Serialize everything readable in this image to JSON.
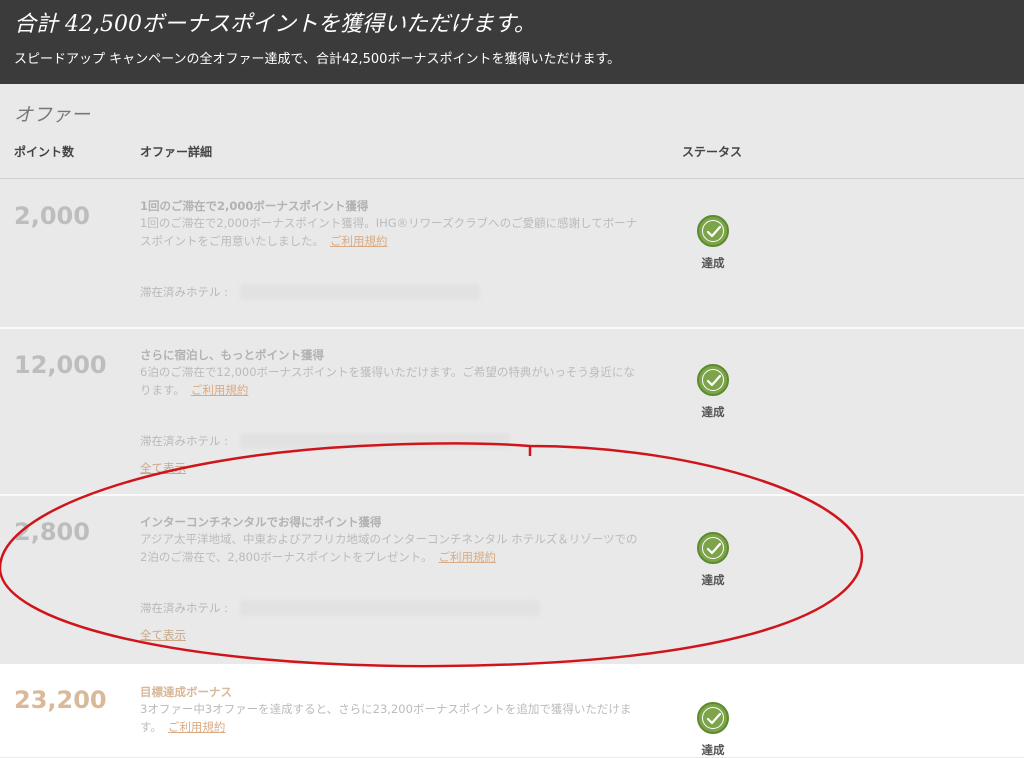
{
  "banner": {
    "title": "合計 42,500ボーナスポイントを獲得いただけます。",
    "subtitle": "スピードアップ キャンペーンの全オファー達成で、合計42,500ボーナスポイントを獲得いただけます。"
  },
  "section": {
    "title": "オファー"
  },
  "columns": {
    "points": "ポイント数",
    "details": "オファー詳細",
    "status": "ステータス"
  },
  "offers": [
    {
      "points": "2,000",
      "title": "1回のご滞在で2,000ボーナスポイント獲得",
      "description": "1回のご滞在で2,000ボーナスポイント獲得。IHG®リワーズクラブへのご愛顧に感謝してボーナスポイントをご用意いたしました。",
      "terms": "ご利用規約",
      "stay_label": "滞在済みホテル :",
      "status": "達成"
    },
    {
      "points": "12,000",
      "title": "さらに宿泊し、もっとポイント獲得",
      "description": "6泊のご滞在で12,000ボーナスポイントを獲得いただけます。ご希望の特典がいっそう身近になります。",
      "terms": "ご利用規約",
      "stay_label": "滞在済みホテル :",
      "show_all": "全て表示",
      "status": "達成"
    },
    {
      "points": "2,800",
      "title": "インターコンチネンタルでお得にポイント獲得",
      "description": "アジア太平洋地域、中東およびアフリカ地域のインターコンチネンタル ホテルズ＆リゾーツでの2泊のご滞在で、2,800ボーナスポイントをプレゼント。",
      "terms": "ご利用規約",
      "stay_label": "滞在済みホテル :",
      "show_all": "全て表示",
      "status": "達成"
    },
    {
      "points": "23,200",
      "title": "目標達成ボーナス",
      "description": "3オファー中3オファーを達成すると、さらに23,200ボーナスポイントを追加で獲得いただけます。",
      "terms": "ご利用規約",
      "status": "達成"
    }
  ],
  "colors": {
    "banner_bg": "#3b3b3b",
    "check_green": "#7da44a",
    "link_orange": "#d9ab84",
    "annotation_red": "#d0141c"
  },
  "icons": {
    "status_icon": "checkmark-circle-icon"
  }
}
